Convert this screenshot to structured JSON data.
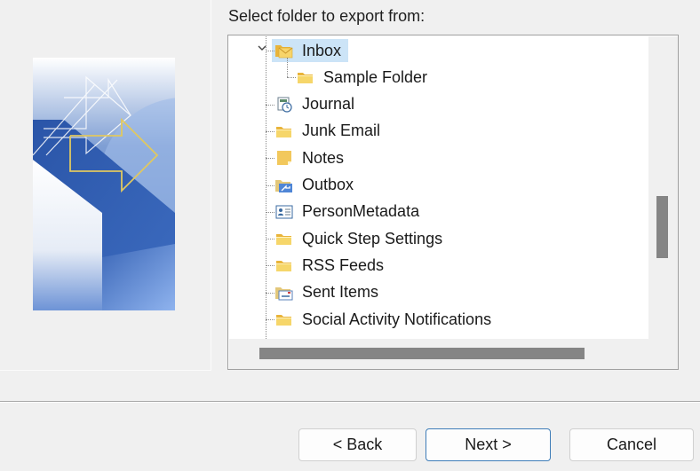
{
  "prompt": "Select folder to export from:",
  "tree": {
    "items": [
      {
        "label": "Inbox",
        "icon": "inbox-folder-icon",
        "level": 1,
        "expanded": true,
        "selected": true
      },
      {
        "label": "Sample Folder",
        "icon": "folder-icon",
        "level": 2,
        "selected": false
      },
      {
        "label": "Journal",
        "icon": "journal-icon",
        "level": 1,
        "selected": false
      },
      {
        "label": "Junk Email",
        "icon": "folder-icon",
        "level": 1,
        "selected": false
      },
      {
        "label": "Notes",
        "icon": "notes-icon",
        "level": 1,
        "selected": false
      },
      {
        "label": "Outbox",
        "icon": "outbox-folder-icon",
        "level": 1,
        "selected": false
      },
      {
        "label": "PersonMetadata",
        "icon": "contact-card-icon",
        "level": 1,
        "selected": false
      },
      {
        "label": "Quick Step Settings",
        "icon": "folder-icon",
        "level": 1,
        "selected": false
      },
      {
        "label": "RSS Feeds",
        "icon": "folder-icon",
        "level": 1,
        "selected": false
      },
      {
        "label": "Sent Items",
        "icon": "sent-folder-icon",
        "level": 1,
        "selected": false
      },
      {
        "label": "Social Activity Notifications",
        "icon": "folder-icon",
        "level": 1,
        "selected": false
      }
    ]
  },
  "buttons": {
    "back": "< Back",
    "next": "Next >",
    "cancel": "Cancel"
  },
  "colors": {
    "selection": "#cce4f7",
    "default_button_border": "#3d7cb8",
    "folder_yellow": "#f2c84b"
  }
}
